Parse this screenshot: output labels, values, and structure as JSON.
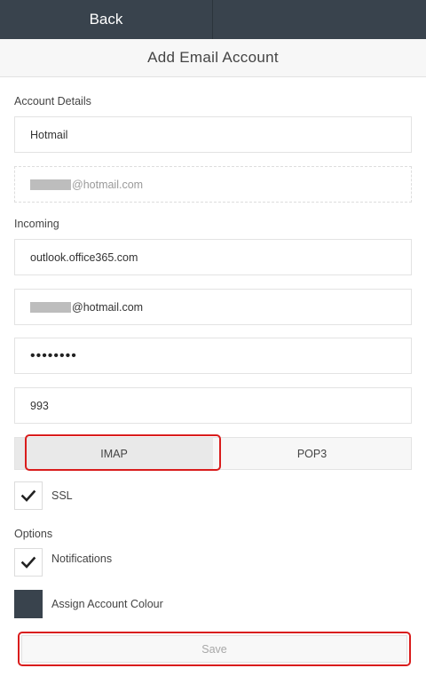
{
  "header": {
    "back_label": "Back",
    "title": "Add Email Account"
  },
  "account_details": {
    "label": "Account Details",
    "account_name": "Hotmail",
    "email_suffix": "@hotmail.com"
  },
  "incoming": {
    "label": "Incoming",
    "server": "outlook.office365.com",
    "username_suffix": "@hotmail.com",
    "password": "••••••••",
    "port": "993",
    "protocols": [
      {
        "label": "IMAP",
        "selected": true
      },
      {
        "label": "POP3",
        "selected": false
      }
    ],
    "ssl_label": "SSL",
    "ssl_checked": true
  },
  "options": {
    "label": "Options",
    "notifications_label": "Notifications",
    "notifications_checked": true,
    "assign_colour_label": "Assign Account Colour",
    "account_colour": "#39434d"
  },
  "save_label": "Save",
  "colors": {
    "header_bg": "#39434d",
    "highlight_red": "#d91c1c"
  }
}
